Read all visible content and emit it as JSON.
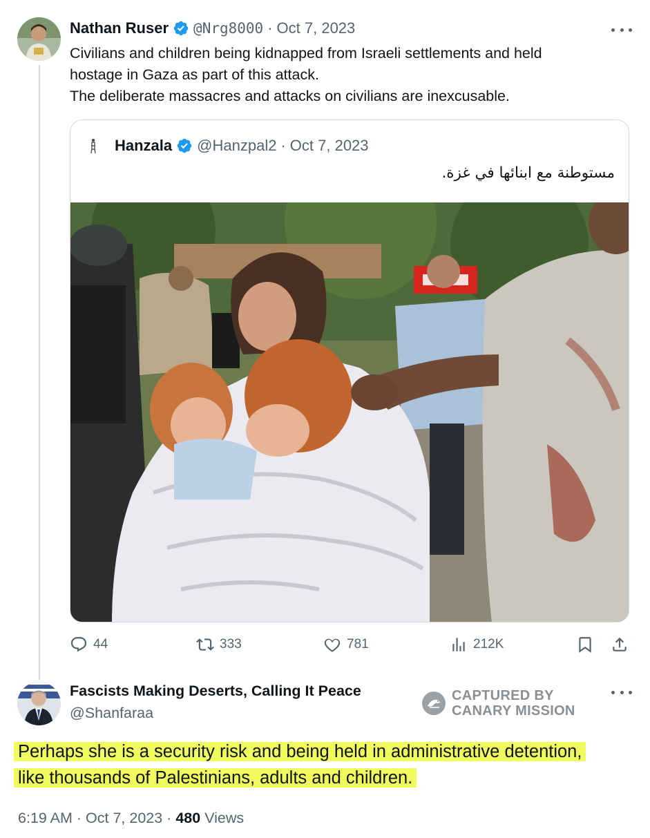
{
  "tweet": {
    "author_name": "Nathan Ruser",
    "author_handle": "@Nrg8000",
    "separator": "·",
    "date": "Oct 7, 2023",
    "text_line1": "Civilians and children being kidnapped from Israeli settlements and held",
    "text_line2": "hostage in Gaza as part of this attack.",
    "text_line3": "The deliberate massacres and attacks on civilians are inexcusable.",
    "verified_icon": "verified-badge-icon",
    "more_icon": "more-options-icon"
  },
  "quote": {
    "author_name": "Hanzala",
    "author_handle": "@Hanzpal2",
    "separator": "·",
    "date": "Oct 7, 2023",
    "text": "مستوطنة مع ابنائها في غزة."
  },
  "actions": {
    "replies": "44",
    "retweets": "333",
    "likes": "781",
    "views": "212K",
    "icons": [
      "reply-icon",
      "retweet-icon",
      "like-icon",
      "views-icon",
      "bookmark-icon",
      "share-icon"
    ]
  },
  "reply": {
    "author_name": "Fascists Making Deserts, Calling It Peace",
    "author_handle": "@Shanfaraa",
    "text_line1": "Perhaps she is a security risk and being held in administrative detention,",
    "text_line2": "like thousands of Palestinians, adults and children.",
    "highlight_color": "#f2fb5d",
    "time": "6:19 AM",
    "separator": "·",
    "date": "Oct 7, 2023",
    "views_count": "480",
    "views_label": "Views"
  },
  "watermark": {
    "line1": "CAPTURED BY",
    "line2": "CANARY MISSION"
  },
  "colors": {
    "text": "#0f1419",
    "muted": "#536471",
    "verified": "#1d9bf0",
    "border": "#cfd9de"
  }
}
